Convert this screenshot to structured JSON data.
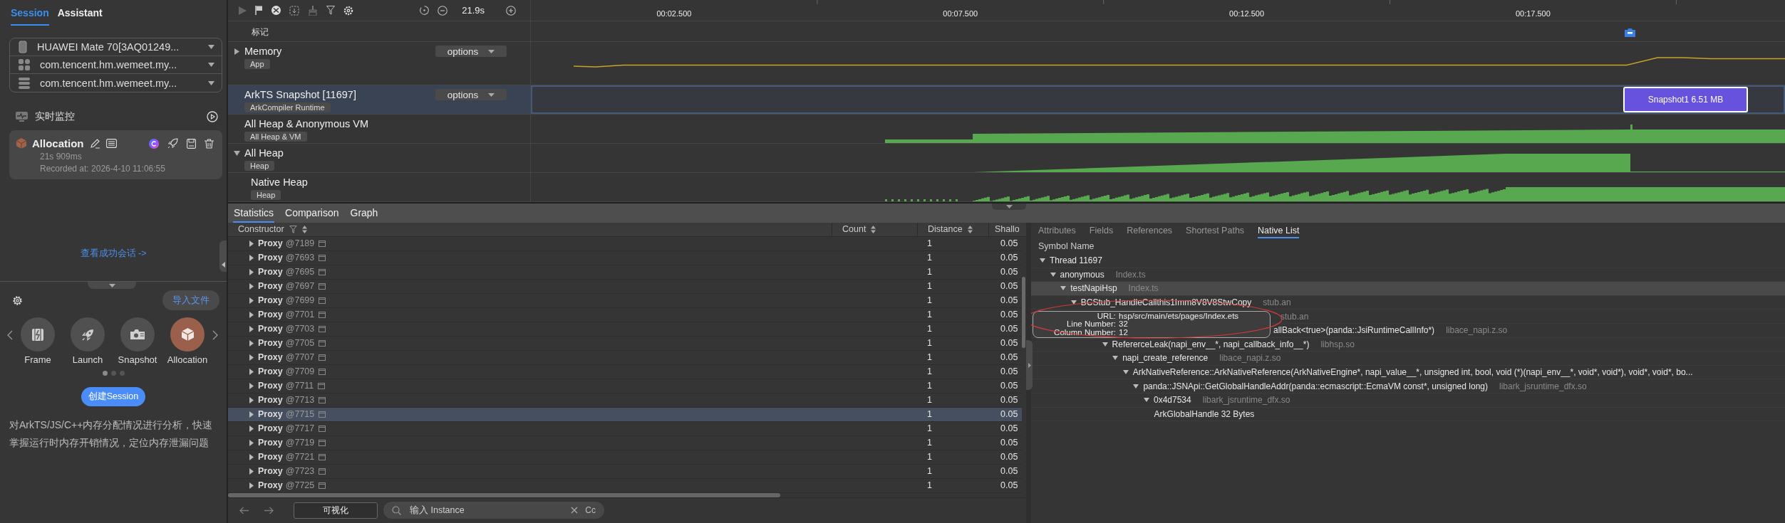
{
  "sidebar": {
    "tabs": [
      {
        "label": "Session",
        "selected": true
      },
      {
        "label": "Assistant",
        "selected": false
      }
    ],
    "selectors": [
      {
        "kind": "device",
        "value": "HUAWEI Mate 70[3AQ01249..."
      },
      {
        "kind": "app",
        "value": "com.tencent.hm.wemeet.my..."
      },
      {
        "kind": "process",
        "value": "com.tencent.hm.wemeet.my..."
      }
    ],
    "monitor_label": "实时监控",
    "session_card": {
      "title": "Allocation",
      "duration": "21s 909ms",
      "recorded": "Recorded at: 2026-4-10 11:06:55"
    },
    "view_link": "查看成功会话 ->",
    "import_button": "导入文件",
    "templates": [
      {
        "kind": "frame",
        "label": "Frame",
        "selected": false
      },
      {
        "kind": "launch",
        "label": "Launch",
        "selected": false
      },
      {
        "kind": "snapshot",
        "label": "Snapshot",
        "selected": false
      },
      {
        "kind": "allocation",
        "label": "Allocation",
        "selected": true
      }
    ],
    "pager": [
      {
        "selected": true
      },
      {
        "selected": false
      },
      {
        "selected": false
      }
    ],
    "create_button": "创建Session",
    "description": "对ArkTS/JS/C++内存分配情况进行分析，快速掌握运行时内存开销情况，定位内存泄漏问题"
  },
  "timeline": {
    "duration": "21.9s",
    "ticks": [
      "00:02.500",
      "00:07.500",
      "00:12.500",
      "00:17.500"
    ],
    "marker_label": "标记",
    "tracks": [
      {
        "kind": "line",
        "name": "Memory",
        "tag": "App",
        "expanded": false,
        "options": "options",
        "selected": false
      },
      {
        "kind": "snapshot",
        "name": "ArkTS Snapshot [11697]",
        "tag": "ArkCompiler Runtime",
        "options": "options",
        "selected": true
      },
      {
        "kind": "area",
        "name": "All Heap & Anonymous VM",
        "tag": "All Heap & VM",
        "selected": false
      },
      {
        "kind": "area",
        "name": "All Heap",
        "tag": "Heap",
        "expanded": true,
        "selected": false,
        "children": [
          {
            "kind": "area",
            "name": "Native Heap",
            "tag": "Heap",
            "selected": false
          }
        ]
      }
    ],
    "snapshot": {
      "label": "Snapshot1 6.51 MB"
    }
  },
  "statistics": {
    "tabs": [
      {
        "label": "Statistics",
        "selected": true
      },
      {
        "label": "Comparison",
        "selected": false
      },
      {
        "label": "Graph",
        "selected": false
      }
    ],
    "columns": [
      "Constructor",
      "Count",
      "Distance",
      "Shallo"
    ],
    "rows": [
      {
        "constructor": "Proxy",
        "id": "@7189",
        "distance": "1",
        "shallow": "0.05",
        "selected": false
      },
      {
        "constructor": "Proxy",
        "id": "@7693",
        "distance": "1",
        "shallow": "0.05",
        "selected": false
      },
      {
        "constructor": "Proxy",
        "id": "@7695",
        "distance": "1",
        "shallow": "0.05",
        "selected": false
      },
      {
        "constructor": "Proxy",
        "id": "@7697",
        "distance": "1",
        "shallow": "0.05",
        "selected": false
      },
      {
        "constructor": "Proxy",
        "id": "@7699",
        "distance": "1",
        "shallow": "0.05",
        "selected": false
      },
      {
        "constructor": "Proxy",
        "id": "@7701",
        "distance": "1",
        "shallow": "0.05",
        "selected": false
      },
      {
        "constructor": "Proxy",
        "id": "@7703",
        "distance": "1",
        "shallow": "0.05",
        "selected": false
      },
      {
        "constructor": "Proxy",
        "id": "@7705",
        "distance": "1",
        "shallow": "0.05",
        "selected": false
      },
      {
        "constructor": "Proxy",
        "id": "@7707",
        "distance": "1",
        "shallow": "0.05",
        "selected": false
      },
      {
        "constructor": "Proxy",
        "id": "@7709",
        "distance": "1",
        "shallow": "0.05",
        "selected": false
      },
      {
        "constructor": "Proxy",
        "id": "@7711",
        "distance": "1",
        "shallow": "0.05",
        "selected": false
      },
      {
        "constructor": "Proxy",
        "id": "@7713",
        "distance": "1",
        "shallow": "0.05",
        "selected": false
      },
      {
        "constructor": "Proxy",
        "id": "@7715",
        "distance": "1",
        "shallow": "0.05",
        "selected": true
      },
      {
        "constructor": "Proxy",
        "id": "@7717",
        "distance": "1",
        "shallow": "0.05",
        "selected": false
      },
      {
        "constructor": "Proxy",
        "id": "@7719",
        "distance": "1",
        "shallow": "0.05",
        "selected": false
      },
      {
        "constructor": "Proxy",
        "id": "@7721",
        "distance": "1",
        "shallow": "0.05",
        "selected": false
      },
      {
        "constructor": "Proxy",
        "id": "@7723",
        "distance": "1",
        "shallow": "0.05",
        "selected": false
      },
      {
        "constructor": "Proxy",
        "id": "@7725",
        "distance": "1",
        "shallow": "0.05",
        "selected": false
      }
    ]
  },
  "footer": {
    "visualize_button": "可视化",
    "search_placeholder": "输入 Instance",
    "case_toggle": "Cc"
  },
  "detail": {
    "tabs": [
      {
        "label": "Attributes",
        "selected": false
      },
      {
        "label": "Fields",
        "selected": false
      },
      {
        "label": "References",
        "selected": false
      },
      {
        "label": "Shortest Paths",
        "selected": false
      },
      {
        "label": "Native List",
        "selected": true
      }
    ],
    "column": "Symbol Name",
    "tree": [
      {
        "name": "Thread 11697",
        "expanded": true,
        "selected": false,
        "children": [
          {
            "name": "anonymous",
            "lib": "Index.ts",
            "expanded": true,
            "selected": false,
            "children": [
              {
                "name": "testNapiHsp",
                "lib": "Index.ts",
                "expanded": true,
                "selected": true,
                "children": [
                  {
                    "name": "BCStub_HandleCallthis1Imm8V8V8StwCopy",
                    "lib": "stub.an",
                    "expanded": true,
                    "selected": false,
                    "children": [
                      {
                        "covered": true,
                        "lib": "stub.an",
                        "selected": false,
                        "children": [
                          {
                            "covered": true,
                            "name": "allBack<true>(panda::JsiRuntimeCallInfo*)",
                            "lib": "libace_napi.z.so",
                            "selected": false,
                            "children": [
                              {
                                "name": "RefererceLeak(napi_env__*, napi_callback_info__*)",
                                "lib": "libhsp.so",
                                "expanded": true,
                                "selected": false,
                                "children": [
                                  {
                                    "name": "napi_create_reference",
                                    "lib": "libace_napi.z.so",
                                    "expanded": true,
                                    "selected": false,
                                    "children": [
                                      {
                                        "name": "ArkNativeReference::ArkNativeReference(ArkNativeEngine*, napi_value__*, unsigned int, bool, void (*)(napi_env__*, void*, void*), void*, void*, bo...",
                                        "expanded": true,
                                        "selected": false,
                                        "children": [
                                          {
                                            "name": "panda::JSNApi::GetGlobalHandleAddr(panda::ecmascript::EcmaVM const*, unsigned long)",
                                            "lib": "libark_jsruntime_dfx.so",
                                            "expanded": true,
                                            "selected": false,
                                            "children": [
                                              {
                                                "name": "0x4d7534",
                                                "lib": "libark_jsruntime_dfx.so",
                                                "expanded": true,
                                                "selected": false,
                                                "children": [
                                                  {
                                                    "name": "ArkGlobalHandle 32 Bytes",
                                                    "selected": false
                                                  }
                                                ]
                                              }
                                            ]
                                          }
                                        ]
                                      }
                                    ]
                                  }
                                ]
                              }
                            ]
                          }
                        ]
                      }
                    ]
                  }
                ]
              }
            ]
          }
        ]
      }
    ],
    "tooltip": [
      {
        "label": "URL:",
        "value": "hsp/src/main/ets/pages/Index.ets"
      },
      {
        "label": "Line Number:",
        "value": "32"
      },
      {
        "label": "Column Number:",
        "value": "12"
      }
    ]
  }
}
